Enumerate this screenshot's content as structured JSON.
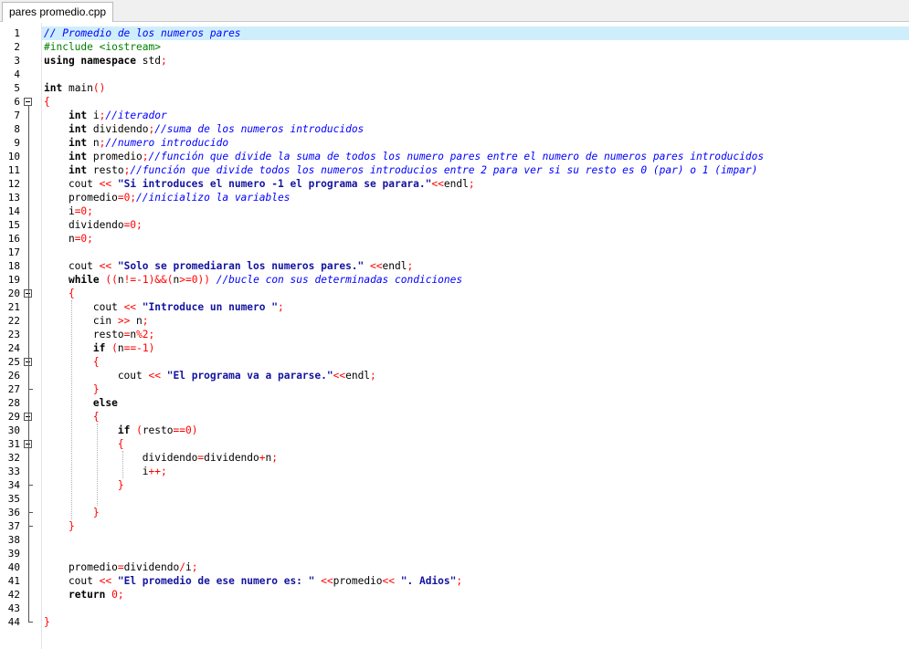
{
  "tab": {
    "title": "pares promedio.cpp"
  },
  "editor": {
    "current_line": 1,
    "lines": [
      {
        "n": "1",
        "t": [
          {
            "c": "cm",
            "v": "// Promedio de los numeros pares"
          }
        ]
      },
      {
        "n": "2",
        "t": [
          {
            "c": "pp",
            "v": "#include <iostream>"
          }
        ]
      },
      {
        "n": "3",
        "t": [
          {
            "c": "kw",
            "v": "using namespace"
          },
          {
            "c": "id",
            "v": " std"
          },
          {
            "c": "op",
            "v": ";"
          }
        ]
      },
      {
        "n": "4",
        "t": []
      },
      {
        "n": "5",
        "t": [
          {
            "c": "kw",
            "v": "int"
          },
          {
            "c": "id",
            "v": " main"
          },
          {
            "c": "op",
            "v": "()"
          }
        ]
      },
      {
        "n": "6",
        "t": [
          {
            "c": "op",
            "v": "{"
          }
        ]
      },
      {
        "n": "7",
        "t": [
          {
            "c": "id",
            "v": "    "
          },
          {
            "c": "kw",
            "v": "int"
          },
          {
            "c": "id",
            "v": " i"
          },
          {
            "c": "op",
            "v": ";"
          },
          {
            "c": "cm",
            "v": "//iterador"
          }
        ]
      },
      {
        "n": "8",
        "t": [
          {
            "c": "id",
            "v": "    "
          },
          {
            "c": "kw",
            "v": "int"
          },
          {
            "c": "id",
            "v": " dividendo"
          },
          {
            "c": "op",
            "v": ";"
          },
          {
            "c": "cm",
            "v": "//suma de los numeros introducidos"
          }
        ]
      },
      {
        "n": "9",
        "t": [
          {
            "c": "id",
            "v": "    "
          },
          {
            "c": "kw",
            "v": "int"
          },
          {
            "c": "id",
            "v": " n"
          },
          {
            "c": "op",
            "v": ";"
          },
          {
            "c": "cm",
            "v": "//numero introducido"
          }
        ]
      },
      {
        "n": "10",
        "t": [
          {
            "c": "id",
            "v": "    "
          },
          {
            "c": "kw",
            "v": "int"
          },
          {
            "c": "id",
            "v": " promedio"
          },
          {
            "c": "op",
            "v": ";"
          },
          {
            "c": "cm",
            "v": "//función que divide la suma de todos los numero pares entre el numero de numeros pares introducidos"
          }
        ]
      },
      {
        "n": "11",
        "t": [
          {
            "c": "id",
            "v": "    "
          },
          {
            "c": "kw",
            "v": "int"
          },
          {
            "c": "id",
            "v": " resto"
          },
          {
            "c": "op",
            "v": ";"
          },
          {
            "c": "cm",
            "v": "//función que divide todos los numeros introducios entre 2 para ver si su resto es 0 (par) o 1 (impar)"
          }
        ]
      },
      {
        "n": "12",
        "t": [
          {
            "c": "id",
            "v": "    cout "
          },
          {
            "c": "op",
            "v": "<<"
          },
          {
            "c": "id",
            "v": " "
          },
          {
            "c": "st",
            "v": "\"Si introduces el numero -1 el programa se parara.\""
          },
          {
            "c": "op",
            "v": "<<"
          },
          {
            "c": "id",
            "v": "endl"
          },
          {
            "c": "op",
            "v": ";"
          }
        ]
      },
      {
        "n": "13",
        "t": [
          {
            "c": "id",
            "v": "    promedio"
          },
          {
            "c": "op",
            "v": "=0;"
          },
          {
            "c": "cm",
            "v": "//inicializo la variables"
          }
        ]
      },
      {
        "n": "14",
        "t": [
          {
            "c": "id",
            "v": "    i"
          },
          {
            "c": "op",
            "v": "=0;"
          }
        ]
      },
      {
        "n": "15",
        "t": [
          {
            "c": "id",
            "v": "    dividendo"
          },
          {
            "c": "op",
            "v": "=0;"
          }
        ]
      },
      {
        "n": "16",
        "t": [
          {
            "c": "id",
            "v": "    n"
          },
          {
            "c": "op",
            "v": "=0;"
          }
        ]
      },
      {
        "n": "17",
        "t": []
      },
      {
        "n": "18",
        "t": [
          {
            "c": "id",
            "v": "    cout "
          },
          {
            "c": "op",
            "v": "<<"
          },
          {
            "c": "id",
            "v": " "
          },
          {
            "c": "st",
            "v": "\"Solo se promediaran los numeros pares.\""
          },
          {
            "c": "id",
            "v": " "
          },
          {
            "c": "op",
            "v": "<<"
          },
          {
            "c": "id",
            "v": "endl"
          },
          {
            "c": "op",
            "v": ";"
          }
        ]
      },
      {
        "n": "19",
        "t": [
          {
            "c": "id",
            "v": "    "
          },
          {
            "c": "kw",
            "v": "while"
          },
          {
            "c": "id",
            "v": " "
          },
          {
            "c": "op",
            "v": "(("
          },
          {
            "c": "id",
            "v": "n"
          },
          {
            "c": "op",
            "v": "!=-1)&&("
          },
          {
            "c": "id",
            "v": "n"
          },
          {
            "c": "op",
            "v": ">=0))"
          },
          {
            "c": "id",
            "v": " "
          },
          {
            "c": "cm",
            "v": "//bucle con sus determinadas condiciones"
          }
        ]
      },
      {
        "n": "20",
        "t": [
          {
            "c": "id",
            "v": "    "
          },
          {
            "c": "op",
            "v": "{"
          }
        ]
      },
      {
        "n": "21",
        "t": [
          {
            "c": "id",
            "v": "        cout "
          },
          {
            "c": "op",
            "v": "<<"
          },
          {
            "c": "id",
            "v": " "
          },
          {
            "c": "st",
            "v": "\"Introduce un numero \""
          },
          {
            "c": "op",
            "v": ";"
          }
        ]
      },
      {
        "n": "22",
        "t": [
          {
            "c": "id",
            "v": "        cin "
          },
          {
            "c": "op",
            "v": ">>"
          },
          {
            "c": "id",
            "v": " n"
          },
          {
            "c": "op",
            "v": ";"
          }
        ]
      },
      {
        "n": "23",
        "t": [
          {
            "c": "id",
            "v": "        resto"
          },
          {
            "c": "op",
            "v": "="
          },
          {
            "c": "id",
            "v": "n"
          },
          {
            "c": "op",
            "v": "%2;"
          }
        ]
      },
      {
        "n": "24",
        "t": [
          {
            "c": "id",
            "v": "        "
          },
          {
            "c": "kw",
            "v": "if"
          },
          {
            "c": "id",
            "v": " "
          },
          {
            "c": "op",
            "v": "("
          },
          {
            "c": "id",
            "v": "n"
          },
          {
            "c": "op",
            "v": "==-1)"
          }
        ]
      },
      {
        "n": "25",
        "t": [
          {
            "c": "id",
            "v": "        "
          },
          {
            "c": "op",
            "v": "{"
          }
        ]
      },
      {
        "n": "26",
        "t": [
          {
            "c": "id",
            "v": "            cout "
          },
          {
            "c": "op",
            "v": "<<"
          },
          {
            "c": "id",
            "v": " "
          },
          {
            "c": "st",
            "v": "\"El programa va a pararse.\""
          },
          {
            "c": "op",
            "v": "<<"
          },
          {
            "c": "id",
            "v": "endl"
          },
          {
            "c": "op",
            "v": ";"
          }
        ]
      },
      {
        "n": "27",
        "t": [
          {
            "c": "id",
            "v": "        "
          },
          {
            "c": "op",
            "v": "}"
          }
        ]
      },
      {
        "n": "28",
        "t": [
          {
            "c": "id",
            "v": "        "
          },
          {
            "c": "kw",
            "v": "else"
          }
        ]
      },
      {
        "n": "29",
        "t": [
          {
            "c": "id",
            "v": "        "
          },
          {
            "c": "op",
            "v": "{"
          }
        ]
      },
      {
        "n": "30",
        "t": [
          {
            "c": "id",
            "v": "            "
          },
          {
            "c": "kw",
            "v": "if"
          },
          {
            "c": "id",
            "v": " "
          },
          {
            "c": "op",
            "v": "("
          },
          {
            "c": "id",
            "v": "resto"
          },
          {
            "c": "op",
            "v": "==0)"
          }
        ]
      },
      {
        "n": "31",
        "t": [
          {
            "c": "id",
            "v": "            "
          },
          {
            "c": "op",
            "v": "{"
          }
        ]
      },
      {
        "n": "32",
        "t": [
          {
            "c": "id",
            "v": "                dividendo"
          },
          {
            "c": "op",
            "v": "="
          },
          {
            "c": "id",
            "v": "dividendo"
          },
          {
            "c": "op",
            "v": "+"
          },
          {
            "c": "id",
            "v": "n"
          },
          {
            "c": "op",
            "v": ";"
          }
        ]
      },
      {
        "n": "33",
        "t": [
          {
            "c": "id",
            "v": "                i"
          },
          {
            "c": "op",
            "v": "++;"
          }
        ]
      },
      {
        "n": "34",
        "t": [
          {
            "c": "id",
            "v": "            "
          },
          {
            "c": "op",
            "v": "}"
          }
        ]
      },
      {
        "n": "35",
        "t": []
      },
      {
        "n": "36",
        "t": [
          {
            "c": "id",
            "v": "        "
          },
          {
            "c": "op",
            "v": "}"
          }
        ]
      },
      {
        "n": "37",
        "t": [
          {
            "c": "id",
            "v": "    "
          },
          {
            "c": "op",
            "v": "}"
          }
        ]
      },
      {
        "n": "38",
        "t": []
      },
      {
        "n": "39",
        "t": []
      },
      {
        "n": "40",
        "t": [
          {
            "c": "id",
            "v": "    promedio"
          },
          {
            "c": "op",
            "v": "="
          },
          {
            "c": "id",
            "v": "dividendo"
          },
          {
            "c": "op",
            "v": "/"
          },
          {
            "c": "id",
            "v": "i"
          },
          {
            "c": "op",
            "v": ";"
          }
        ]
      },
      {
        "n": "41",
        "t": [
          {
            "c": "id",
            "v": "    cout "
          },
          {
            "c": "op",
            "v": "<<"
          },
          {
            "c": "id",
            "v": " "
          },
          {
            "c": "st",
            "v": "\"El promedio de ese numero es: \""
          },
          {
            "c": "id",
            "v": " "
          },
          {
            "c": "op",
            "v": "<<"
          },
          {
            "c": "id",
            "v": "promedio"
          },
          {
            "c": "op",
            "v": "<<"
          },
          {
            "c": "id",
            "v": " "
          },
          {
            "c": "st",
            "v": "\". Adios\""
          },
          {
            "c": "op",
            "v": ";"
          }
        ]
      },
      {
        "n": "42",
        "t": [
          {
            "c": "id",
            "v": "    "
          },
          {
            "c": "kw",
            "v": "return"
          },
          {
            "c": "id",
            "v": " "
          },
          {
            "c": "op",
            "v": "0;"
          }
        ]
      },
      {
        "n": "43",
        "t": []
      },
      {
        "n": "44",
        "t": [
          {
            "c": "op",
            "v": "}"
          }
        ]
      }
    ],
    "fold_markers": [
      "6",
      "20",
      "25",
      "29",
      "31"
    ]
  },
  "colors": {
    "keyword": "#000000",
    "comment": "#0000ff",
    "string": "#1414a0",
    "preprocessor": "#008000",
    "operator": "#ff0000",
    "current_line_bg": "#cfeefc"
  }
}
